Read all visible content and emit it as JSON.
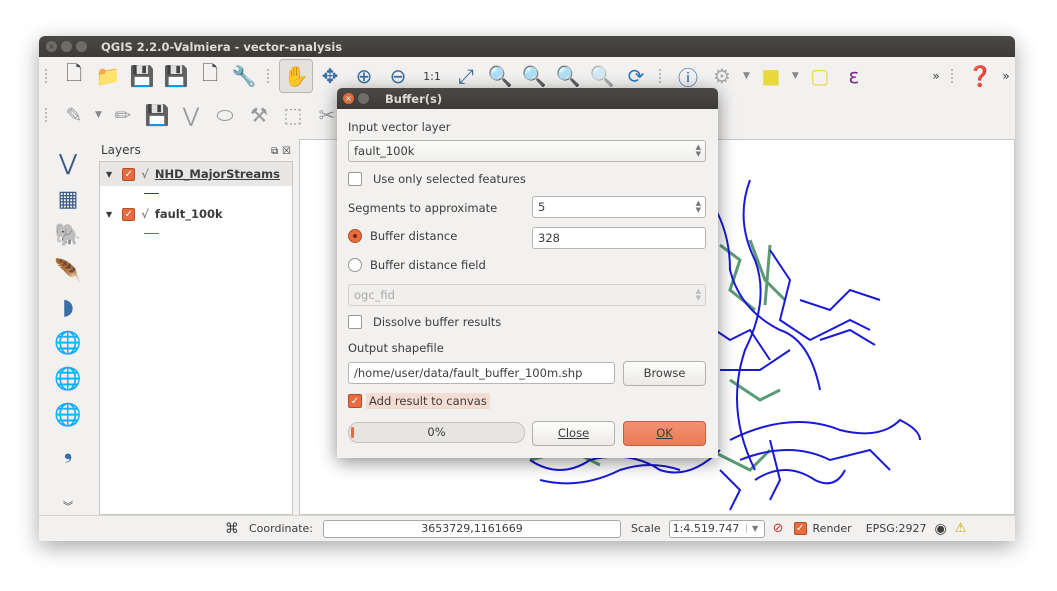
{
  "window": {
    "title": "QGIS 2.2.0-Valmiera - vector-analysis"
  },
  "toolbar_top": {
    "items": [
      "new-project",
      "open-project",
      "save-project",
      "save-as",
      "new-print-composer",
      "composer-manager",
      "pan-map",
      "pan-to-selection",
      "zoom-in",
      "zoom-out",
      "zoom-native",
      "zoom-full",
      "zoom-to-selection",
      "zoom-to-layer",
      "zoom-last",
      "zoom-next",
      "refresh",
      "identify",
      "run-feature-action",
      "select-features",
      "deselect-all",
      "select-by-expression",
      "more",
      "help"
    ]
  },
  "layers_panel": {
    "title": "Layers",
    "layers": [
      {
        "name": "NHD_MajorStreams",
        "checked": true,
        "color": "#2b2bd9"
      },
      {
        "name": "fault_100k",
        "checked": true,
        "color": "#3e8a5a"
      }
    ]
  },
  "dialog": {
    "title": "Buffer(s)",
    "input_label": "Input vector layer",
    "input_value": "fault_100k",
    "use_selected_label": "Use only selected features",
    "use_selected": false,
    "segments_label": "Segments to approximate",
    "segments_value": "5",
    "buffer_distance_label": "Buffer distance",
    "buffer_distance_value": "328",
    "buffer_field_label": "Buffer distance field",
    "buffer_field_value": "ogc_fid",
    "dissolve_label": "Dissolve buffer results",
    "dissolve": false,
    "output_label": "Output shapefile",
    "output_value": "/home/user/data/fault_buffer_100m.shp",
    "browse_label": "Browse",
    "add_to_canvas_label": "Add result to canvas",
    "add_to_canvas": true,
    "progress": 0,
    "progress_label": "0%",
    "close_label": "Close",
    "ok_label": "OK"
  },
  "statusbar": {
    "coordinate_label": "Coordinate:",
    "coordinate_value": "3653729,1161669",
    "scale_label": "Scale",
    "scale_value": "1:4.519.747",
    "render_label": "Render",
    "render": true,
    "crs": "EPSG:2927"
  },
  "colors": {
    "accent": "#e86c3f",
    "streams": "#1a1ad6",
    "faults": "#3e8a5a"
  }
}
